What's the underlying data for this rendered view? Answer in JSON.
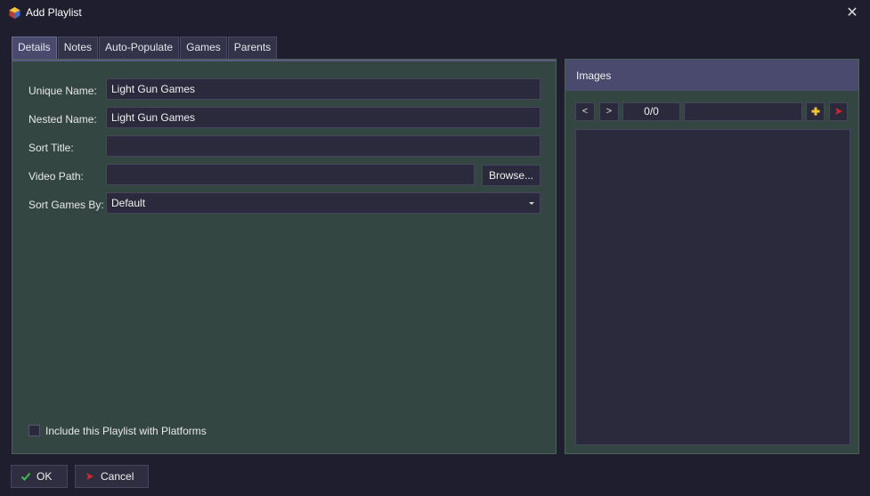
{
  "window": {
    "title": "Add Playlist",
    "close_glyph": "✕",
    "icon": "app-logo-icon"
  },
  "tabs": [
    {
      "label": "Details",
      "active": true
    },
    {
      "label": "Notes",
      "active": false
    },
    {
      "label": "Auto-Populate",
      "active": false
    },
    {
      "label": "Games",
      "active": false
    },
    {
      "label": "Parents",
      "active": false
    }
  ],
  "form": {
    "unique_name": {
      "label": "Unique Name:",
      "value": "Light Gun Games"
    },
    "nested_name": {
      "label": "Nested Name:",
      "value": "Light Gun Games"
    },
    "sort_title": {
      "label": "Sort Title:",
      "value": ""
    },
    "video_path": {
      "label": "Video Path:",
      "value": "",
      "browse_label": "Browse..."
    },
    "sort_games_by": {
      "label": "Sort Games By:",
      "value": "Default"
    },
    "include_with_platforms": {
      "label": "Include this Playlist with Platforms",
      "checked": false
    }
  },
  "images": {
    "title": "Images",
    "prev_label": "<",
    "next_label": ">",
    "counter": "0/0",
    "image_type": "",
    "add_icon": "add-image-icon",
    "remove_icon": "remove-image-icon"
  },
  "footer": {
    "ok_label": "OK",
    "cancel_label": "Cancel"
  },
  "colors": {
    "background": "#1f1e2e",
    "panel": "#334641",
    "header": "#4a4a6e",
    "field": "#2a2a3c",
    "ok_check": "#3fb950",
    "cancel_x": "#d02a2a"
  }
}
